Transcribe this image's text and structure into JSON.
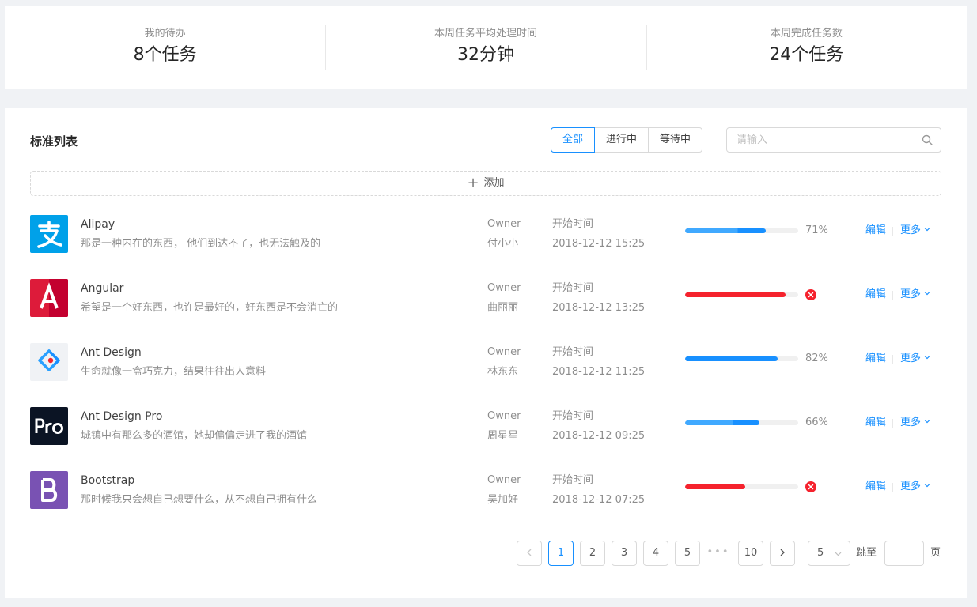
{
  "stats": [
    {
      "label": "我的待办",
      "value": "8个任务"
    },
    {
      "label": "本周任务平均处理时间",
      "value": "32分钟"
    },
    {
      "label": "本周完成任务数",
      "value": "24个任务"
    }
  ],
  "list": {
    "title": "标准列表",
    "filters": [
      "全部",
      "进行中",
      "等待中"
    ],
    "active_filter": "全部",
    "search_placeholder": "请输入",
    "add_label": "添加",
    "owner_label": "Owner",
    "time_label": "开始时间",
    "edit_label": "编辑",
    "more_label": "更多",
    "items": [
      {
        "title": "Alipay",
        "desc": "那是一种内在的东西， 他们到达不了，也无法触及的",
        "owner": "付小小",
        "start": "2018-12-12 15:25",
        "percent": 71,
        "percent_text": "71%",
        "status": "active",
        "icon": "alipay-logo",
        "color": "#1890ff"
      },
      {
        "title": "Angular",
        "desc": "希望是一个好东西，也许是最好的，好东西是不会消亡的",
        "owner": "曲丽丽",
        "start": "2018-12-12 13:25",
        "percent": 89,
        "percent_text": "",
        "status": "exception",
        "icon": "angular-logo",
        "color": "#f5222d"
      },
      {
        "title": "Ant Design",
        "desc": "生命就像一盒巧克力，结果往往出人意料",
        "owner": "林东东",
        "start": "2018-12-12 11:25",
        "percent": 82,
        "percent_text": "82%",
        "status": "normal",
        "icon": "ant-design-logo",
        "color": "#1890ff"
      },
      {
        "title": "Ant Design Pro",
        "desc": "城镇中有那么多的酒馆，她却偏偏走进了我的酒馆",
        "owner": "周星星",
        "start": "2018-12-12 09:25",
        "percent": 66,
        "percent_text": "66%",
        "status": "active",
        "icon": "ant-design-pro-logo",
        "color": "#1890ff"
      },
      {
        "title": "Bootstrap",
        "desc": "那时候我只会想自己想要什么，从不想自己拥有什么",
        "owner": "吴加好",
        "start": "2018-12-12 07:25",
        "percent": 53,
        "percent_text": "",
        "status": "exception",
        "icon": "bootstrap-logo",
        "color": "#f5222d"
      }
    ]
  },
  "pagination": {
    "pages": [
      "1",
      "2",
      "3",
      "4",
      "5"
    ],
    "current": "1",
    "ellipsis": "•••",
    "last": "10",
    "page_size": "5",
    "jump_label": "跳至",
    "jump_suffix": "页"
  },
  "colors": {
    "primary": "#1890ff",
    "error": "#f5222d",
    "border": "#d9d9d9",
    "background": "#f0f2f5"
  }
}
